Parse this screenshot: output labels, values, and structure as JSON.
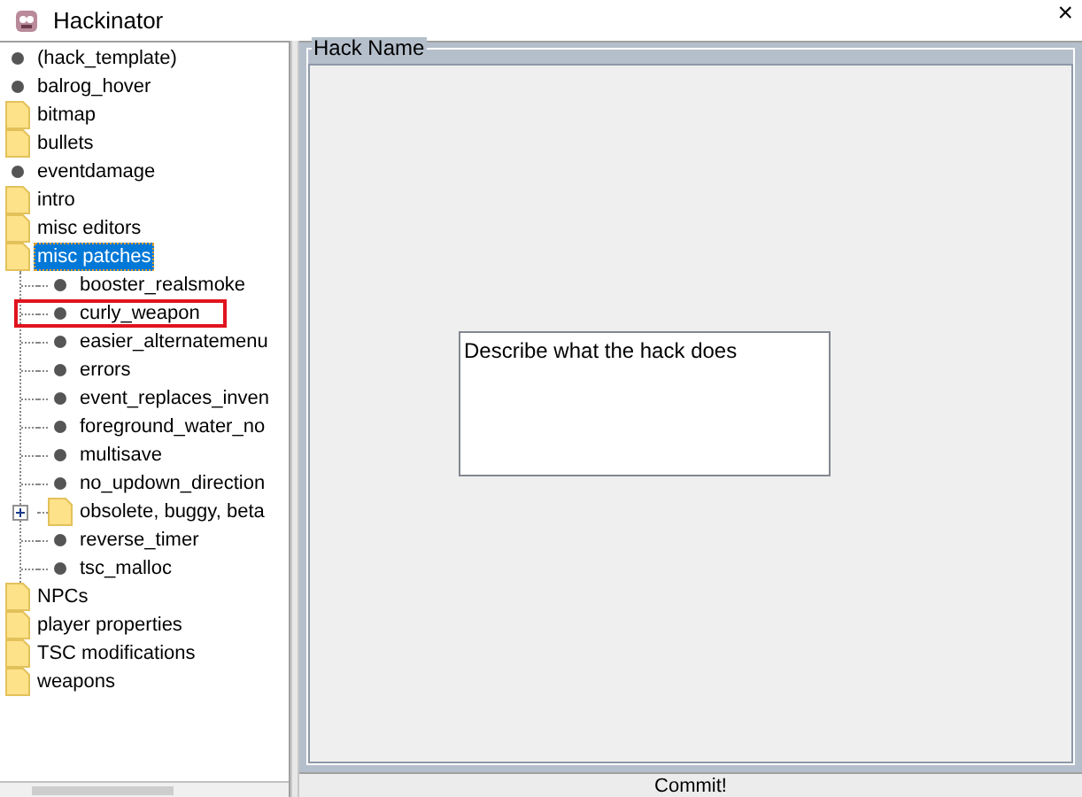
{
  "window": {
    "title": "Hackinator",
    "close": "×"
  },
  "tree": [
    {
      "label": "(hack_template)",
      "kind": "hack",
      "selected": false
    },
    {
      "label": "balrog_hover",
      "kind": "hack",
      "selected": false
    },
    {
      "label": "bitmap",
      "kind": "folder",
      "selected": false
    },
    {
      "label": "bullets",
      "kind": "folder",
      "selected": false
    },
    {
      "label": "eventdamage",
      "kind": "hack",
      "selected": false
    },
    {
      "label": "intro",
      "kind": "folder",
      "selected": false
    },
    {
      "label": "misc editors",
      "kind": "folder",
      "selected": false
    },
    {
      "label": "misc patches",
      "kind": "folder",
      "selected": true,
      "expanded": true,
      "children": [
        {
          "label": "booster_realsmoke",
          "kind": "hack",
          "selected": false,
          "highlighted": false
        },
        {
          "label": "curly_weapon",
          "kind": "hack",
          "selected": false,
          "highlighted": true
        },
        {
          "label": "easier_alternatemenu",
          "kind": "hack",
          "selected": false,
          "highlighted": false
        },
        {
          "label": "errors",
          "kind": "hack",
          "selected": false,
          "highlighted": false
        },
        {
          "label": "event_replaces_inven",
          "kind": "hack",
          "selected": false,
          "highlighted": false
        },
        {
          "label": "foreground_water_no",
          "kind": "hack",
          "selected": false,
          "highlighted": false
        },
        {
          "label": "multisave",
          "kind": "hack",
          "selected": false,
          "highlighted": false
        },
        {
          "label": "no_updown_direction",
          "kind": "hack",
          "selected": false,
          "highlighted": false
        },
        {
          "label": "obsolete, buggy, beta",
          "kind": "folder",
          "selected": false,
          "expanded": false,
          "highlighted": false
        },
        {
          "label": "reverse_timer",
          "kind": "hack",
          "selected": false,
          "highlighted": false
        },
        {
          "label": "tsc_malloc",
          "kind": "hack",
          "selected": false,
          "highlighted": false
        }
      ]
    },
    {
      "label": "NPCs",
      "kind": "folder",
      "selected": false
    },
    {
      "label": "player properties",
      "kind": "folder",
      "selected": false
    },
    {
      "label": "TSC modifications",
      "kind": "folder",
      "selected": false
    },
    {
      "label": "weapons",
      "kind": "folder",
      "selected": false
    }
  ],
  "hack_panel": {
    "title": "Hack Name",
    "description": "Describe what the hack does"
  },
  "commit_button": "Commit!"
}
